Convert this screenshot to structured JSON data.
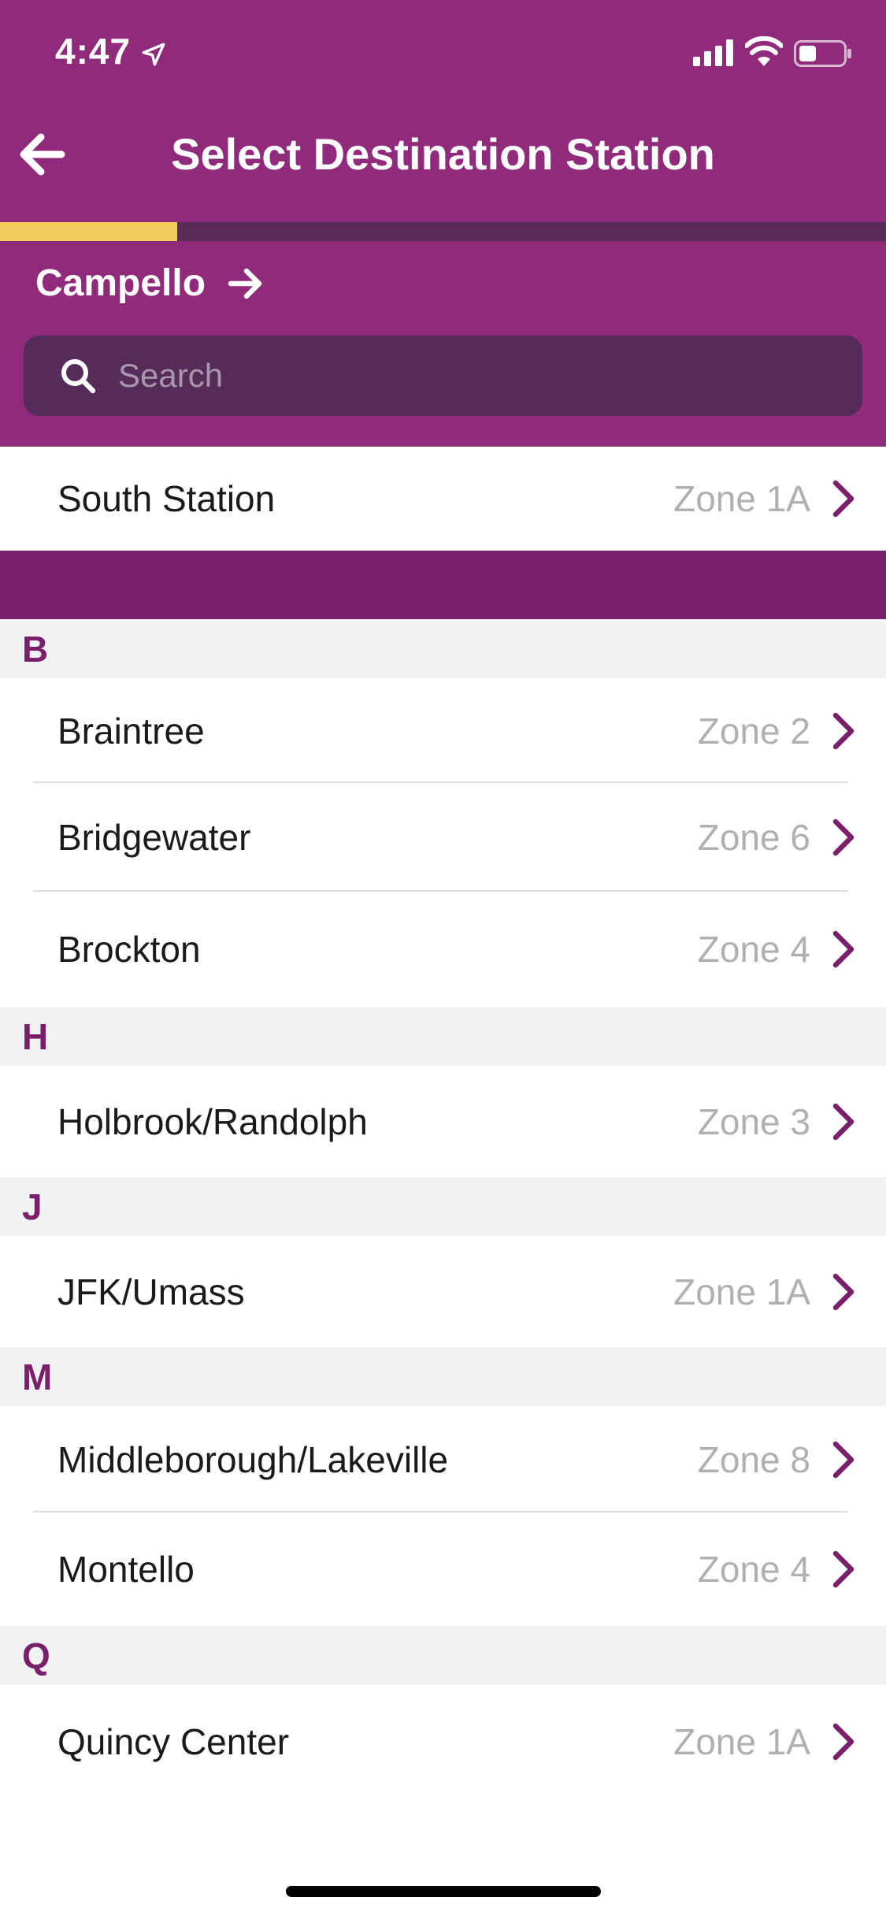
{
  "status": {
    "time": "4:47"
  },
  "nav": {
    "title": "Select Destination Station"
  },
  "progress": {
    "fraction": 0.2
  },
  "origin": {
    "label": "Campello"
  },
  "search": {
    "placeholder": "Search",
    "value": ""
  },
  "featured": {
    "name": "South Station",
    "zone": "Zone 1A"
  },
  "sections": [
    {
      "letter": "B",
      "stations": [
        {
          "name": "Braintree",
          "zone": "Zone 2"
        },
        {
          "name": "Bridgewater",
          "zone": "Zone 6"
        },
        {
          "name": "Brockton",
          "zone": "Zone 4"
        }
      ]
    },
    {
      "letter": "H",
      "stations": [
        {
          "name": "Holbrook/Randolph",
          "zone": "Zone 3"
        }
      ]
    },
    {
      "letter": "J",
      "stations": [
        {
          "name": "JFK/Umass",
          "zone": "Zone 1A"
        }
      ]
    },
    {
      "letter": "M",
      "stations": [
        {
          "name": "Middleborough/Lakeville",
          "zone": "Zone 8"
        },
        {
          "name": "Montello",
          "zone": "Zone 4"
        }
      ]
    },
    {
      "letter": "Q",
      "stations": [
        {
          "name": "Quincy Center",
          "zone": "Zone 1A"
        }
      ]
    }
  ],
  "colors": {
    "header": "#902b7b",
    "accent": "#7a1f6a",
    "progress": "#f2cd5c",
    "zone_text": "#b0b0b0"
  }
}
